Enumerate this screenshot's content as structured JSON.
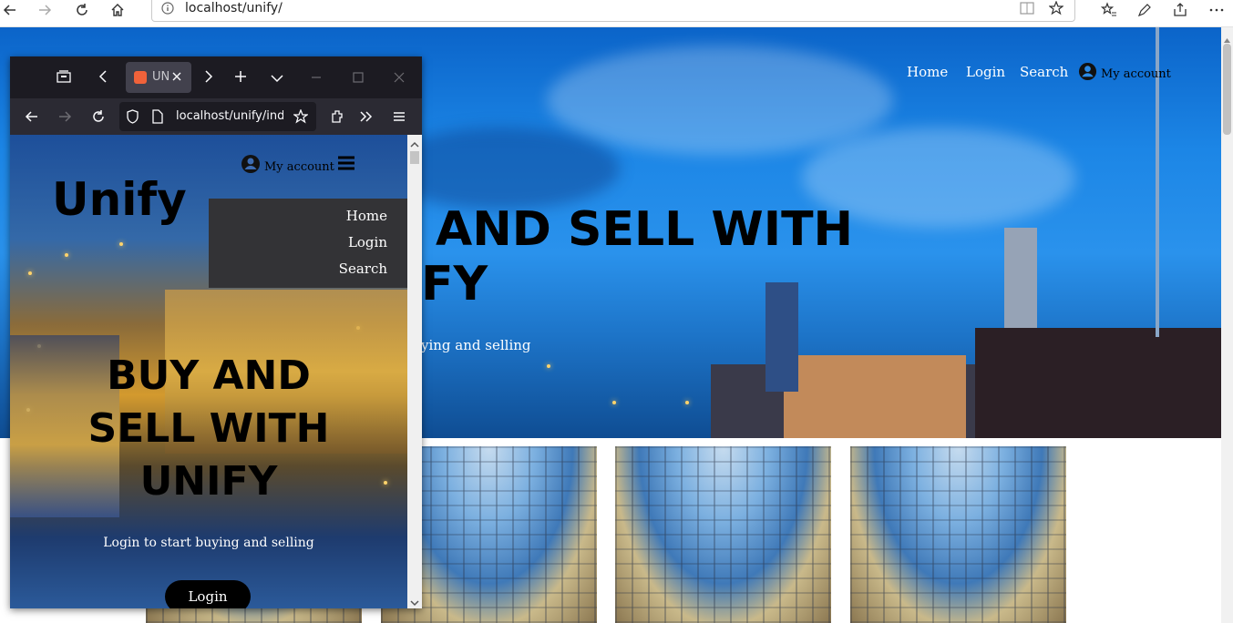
{
  "edge": {
    "url": "localhost/unify/"
  },
  "page": {
    "nav": {
      "home": "Home",
      "login": "Login",
      "search": "Search",
      "account": "My account"
    },
    "hero": {
      "title_line1": "AND SELL WITH",
      "title_line2": "FY",
      "subtitle": "ying and selling"
    }
  },
  "firefox": {
    "tab_title": "UN",
    "url": "localhost/unify/inde",
    "site": {
      "brand": "Unify",
      "account": "My account",
      "menu": {
        "home": "Home",
        "login": "Login",
        "search": "Search"
      },
      "hero": {
        "title": "BUY AND SELL WITH UNIFY",
        "subtitle": "Login to start buying and selling",
        "login_button": "Login"
      }
    }
  }
}
